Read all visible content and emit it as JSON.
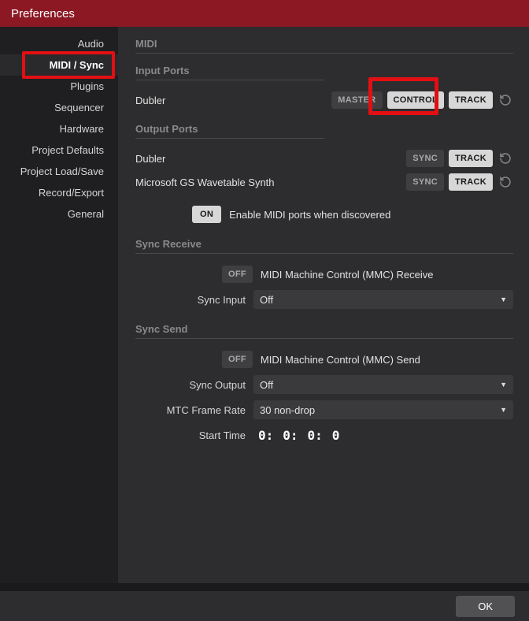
{
  "window": {
    "title": "Preferences"
  },
  "sidebar": {
    "items": [
      {
        "label": "Audio"
      },
      {
        "label": "MIDI / Sync"
      },
      {
        "label": "Plugins"
      },
      {
        "label": "Sequencer"
      },
      {
        "label": "Hardware"
      },
      {
        "label": "Project Defaults"
      },
      {
        "label": "Project Load/Save"
      },
      {
        "label": "Record/Export"
      },
      {
        "label": "General"
      }
    ]
  },
  "sections": {
    "midi_heading": "MIDI",
    "input_ports_heading": "Input Ports",
    "output_ports_heading": "Output Ports",
    "sync_receive_heading": "Sync Receive",
    "sync_send_heading": "Sync Send"
  },
  "ports": {
    "input": [
      {
        "name": "Dubler",
        "master": "MASTER",
        "control": "CONTROL",
        "track": "TRACK"
      }
    ],
    "output": [
      {
        "name": "Dubler",
        "sync": "SYNC",
        "track": "TRACK"
      },
      {
        "name": "Microsoft GS Wavetable Synth",
        "sync": "SYNC",
        "track": "TRACK"
      }
    ]
  },
  "enable_ports": {
    "state": "ON",
    "label": "Enable MIDI ports when discovered"
  },
  "sync_receive": {
    "mmc_state": "OFF",
    "mmc_label": "MIDI Machine Control (MMC) Receive",
    "sync_input_label": "Sync Input",
    "sync_input_value": "Off"
  },
  "sync_send": {
    "mmc_state": "OFF",
    "mmc_label": "MIDI Machine Control (MMC) Send",
    "sync_output_label": "Sync Output",
    "sync_output_value": "Off",
    "mtc_label": "MTC Frame Rate",
    "mtc_value": "30 non-drop",
    "start_time_label": "Start Time",
    "start_time": {
      "h": "0:",
      "m": "0:",
      "s": "0:",
      "f": "0"
    }
  },
  "footer": {
    "ok": "OK"
  }
}
